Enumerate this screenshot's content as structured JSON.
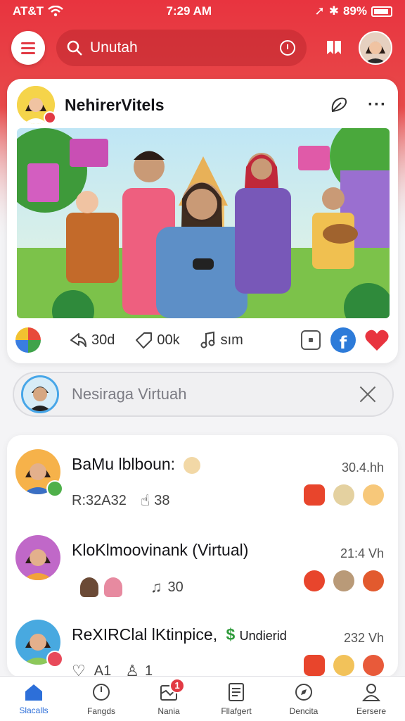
{
  "status_bar": {
    "carrier": "AT&T",
    "time": "7:29 AM",
    "battery": "89%"
  },
  "search": {
    "value": "Unutah"
  },
  "post": {
    "author": "NehirerVitels",
    "stats": {
      "shares": "30d",
      "comments": "00k",
      "music": "sım"
    }
  },
  "message_bar": {
    "text": "Nesiraga Virtuah"
  },
  "list": [
    {
      "title": "BaMu lblboun:",
      "time": "30.4.hh",
      "meta_a": "R:32A32",
      "meta_b": "38"
    },
    {
      "title": "KloKlmoovinank (Virtual)",
      "time": "21:4 Vh",
      "meta_a": "",
      "meta_b": "30"
    },
    {
      "title": "ReXIRClal lKtinpice,",
      "subtitle": "Undierid",
      "time": "232 Vh",
      "meta_a": "A1",
      "meta_b": "1"
    }
  ],
  "nav": [
    {
      "label": "Slacalls"
    },
    {
      "label": "Fangds"
    },
    {
      "label": "Nania",
      "badge": "1"
    },
    {
      "label": "Fllafgert"
    },
    {
      "label": "Dencita"
    },
    {
      "label": "Eersere"
    }
  ],
  "colors": {
    "accent": "#e23a44",
    "nav_active": "#2d6fd9",
    "facebook": "#2d7bd9"
  }
}
